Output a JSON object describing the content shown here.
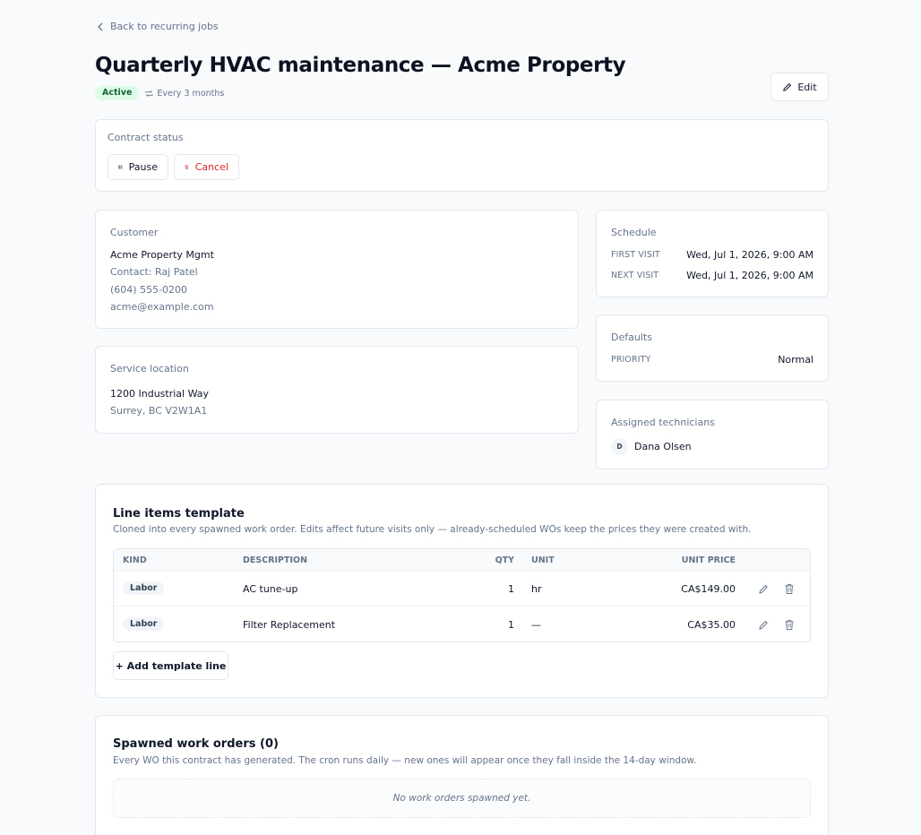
{
  "back_link": {
    "label": "Back to recurring jobs"
  },
  "header": {
    "title": "Quarterly HVAC maintenance — Acme Property",
    "status_badge": "Active",
    "recurrence": "Every 3 months",
    "edit_label": "Edit"
  },
  "contract_status": {
    "label": "Contract status",
    "pause_label": "Pause",
    "cancel_label": "Cancel"
  },
  "customer": {
    "label": "Customer",
    "name": "Acme Property Mgmt",
    "contact": "Contact: Raj Patel",
    "phone": "(604) 555-0200",
    "email": "acme@example.com"
  },
  "service_location": {
    "label": "Service location",
    "line1": "1200 Industrial Way",
    "line2": "Surrey, BC V2W1A1"
  },
  "schedule": {
    "label": "Schedule",
    "first_visit_key": "FIRST VISIT",
    "first_visit_value": "Wed, Jul 1, 2026, 9:00 AM",
    "next_visit_key": "NEXT VISIT",
    "next_visit_value": "Wed, Jul 1, 2026, 9:00 AM"
  },
  "defaults": {
    "label": "Defaults",
    "priority_key": "PRIORITY",
    "priority_value": "Normal"
  },
  "technicians": {
    "label": "Assigned technicians",
    "items": [
      {
        "initial": "D",
        "name": "Dana Olsen"
      }
    ]
  },
  "line_items": {
    "title": "Line items template",
    "subtitle": "Cloned into every spawned work order. Edits affect future visits only — already-scheduled WOs keep the prices they were created with.",
    "columns": {
      "kind": "KIND",
      "description": "DESCRIPTION",
      "qty": "QTY",
      "unit": "UNIT",
      "unit_price": "UNIT PRICE"
    },
    "rows": [
      {
        "kind": "Labor",
        "description": "AC tune-up",
        "qty": "1",
        "unit": "hr",
        "unit_price": "CA$149.00"
      },
      {
        "kind": "Labor",
        "description": "Filter Replacement",
        "qty": "1",
        "unit": "—",
        "unit_price": "CA$35.00"
      }
    ],
    "add_label": "+ Add template line"
  },
  "spawned": {
    "title": "Spawned work orders (0)",
    "subtitle": "Every WO this contract has generated. The cron runs daily — new ones will appear once they fall inside the 14-day window.",
    "empty_text": "No work orders spawned yet."
  },
  "colors": {
    "accent_success": "#166534",
    "danger": "#dc2626",
    "border": "#e2e8f0"
  },
  "icons": [
    "chevron-left-icon",
    "repeat-icon",
    "pencil-icon",
    "pause-icon",
    "trash-icon"
  ]
}
